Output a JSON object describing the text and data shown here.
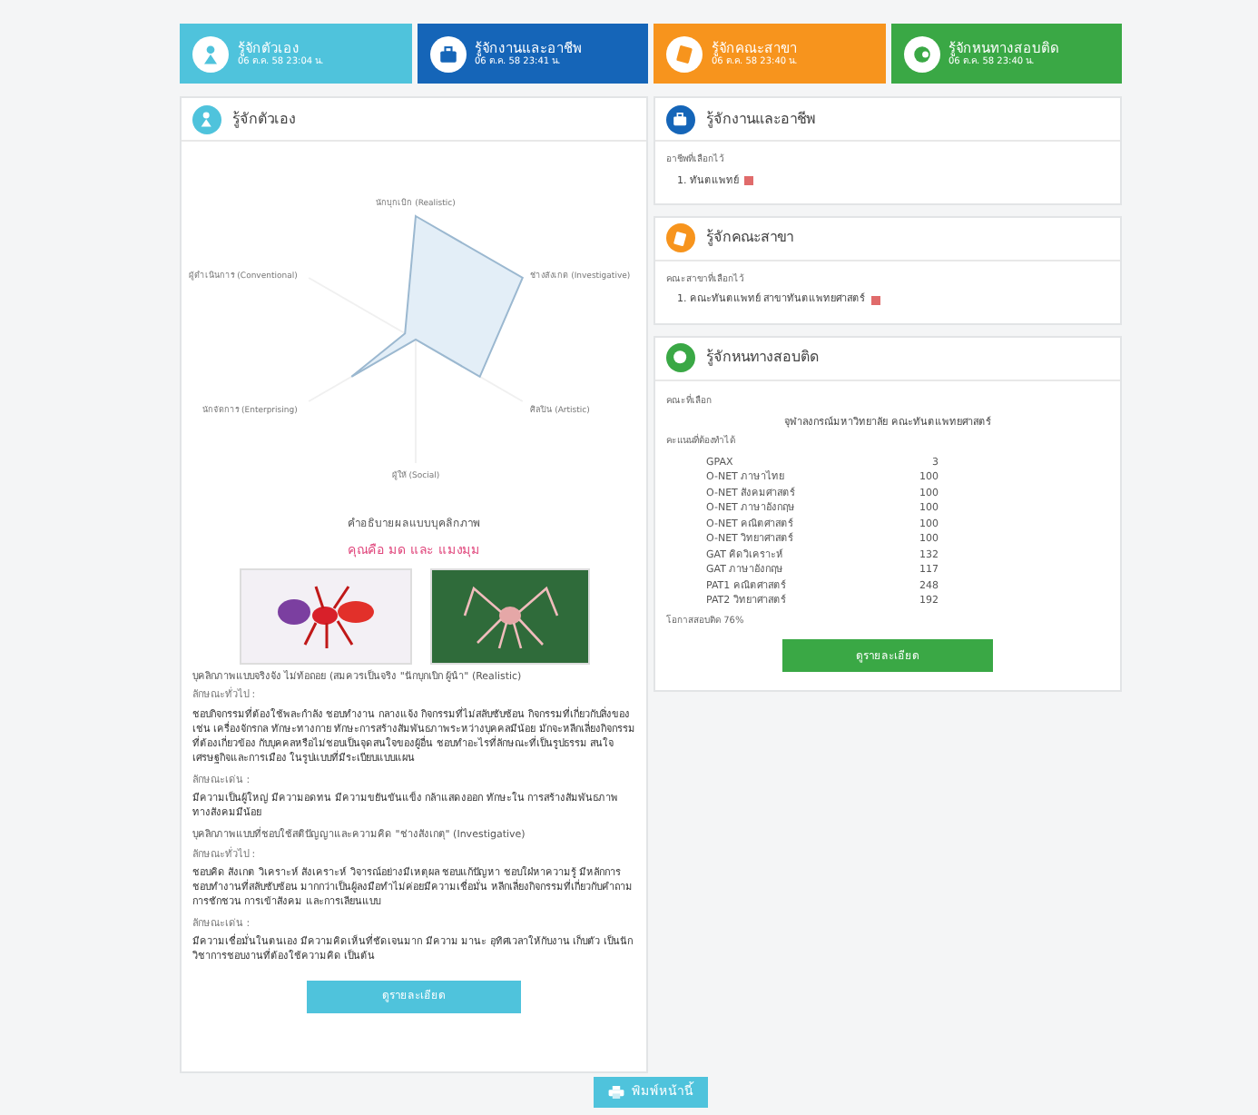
{
  "summary_cards": [
    {
      "title": "รู้จักตัวเอง",
      "time": "06 ต.ค. 58 23:04 น.",
      "color": "#4fc3dc",
      "kind": "person"
    },
    {
      "title": "รู้จักงานและอาชีพ",
      "time": "06 ต.ค. 58 23:41 น.",
      "color": "#1565b8",
      "kind": "briefcase"
    },
    {
      "title": "รู้จักคณะสาขา",
      "time": "06 ต.ค. 58 23:40 น.",
      "color": "#f7941d",
      "kind": "book"
    },
    {
      "title": "รู้จักหนทางสอบติด",
      "time": "06 ต.ค. 58 23:40 น.",
      "color": "#3aa845",
      "kind": "target"
    }
  ],
  "self_panel": {
    "title": "รู้จักตัวเอง",
    "radar_labels": [
      "นักบุกเบิก (Realistic)",
      "ผู้ดำเนินการ (Conventional)",
      "ช่างสังเกต (Investigative)",
      "นักจัดการ (Enterprising)",
      "ศิลปิน (Artistic)",
      "ผู้ให้ (Social)"
    ],
    "caption": "คำอธิบายผลแบบบุคลิกภาพ",
    "result": "คุณคือ มด และ แมงมุม",
    "sections": [
      {
        "kind": "heading",
        "text": "บุคลิกภาพแบบจริงจัง ไม่ท้อถอย (สมควรเป็นจริง \"นักบุกเบิก ผู้นำ\" (Realistic)"
      },
      {
        "kind": "label",
        "text": "ลักษณะทั่วไป :"
      },
      {
        "kind": "body",
        "text": "ชอบกิจกรรมที่ต้องใช้พละกำลัง ชอบทำงาน กลางแจ้ง กิจกรรมที่ไม่สลับซับซ้อน กิจกรรมที่เกี่ยวกับสิ่งของ เช่น เครื่องจักรกล ทักษะทางกาย ทักษะการสร้างสัมพันธภาพระหว่างบุคคลมีน้อย มักจะหลีกเลี่ยงกิจกรรมที่ต้องเกี่ยวข้อง กับบุคคลหรือไม่ชอบเป็นจุดสนใจของผู้อื่น ชอบทำอะไรที่ลักษณะที่เป็นรูปธรรม สนใจเศรษฐกิจและการเมือง ในรูปแบบที่มีระเบียบแบบแผน"
      },
      {
        "kind": "label",
        "text": "ลักษณะเด่น :"
      },
      {
        "kind": "body",
        "text": "มีความเป็นผู้ใหญ่ มีความอดทน มีความขยันขันแข็ง กล้าแสดงออก ทักษะใน การสร้างสัมพันธภาพทางสังคมมีน้อย"
      },
      {
        "kind": "heading",
        "text": "บุคลิกภาพแบบที่ชอบใช้สติปัญญาและความคิด \"ช่างสังเกตุ\" (Investigative)"
      },
      {
        "kind": "label",
        "text": "ลักษณะทั่วไป :"
      },
      {
        "kind": "body",
        "text": "ชอบคิด สังเกต วิเคราะห์ สังเคราะห์ วิจารณ์อย่างมีเหตุผล ชอบแก้ปัญหา ชอบใฝ่หาความรู้ มีหลักการ ชอบทำงานที่สลับซับซ้อน มากกว่าเป็นผู้ลงมือทำไม่ค่อยมีความเชื่อมั่น หลีกเลี่ยงกิจกรรมที่เกี่ยวกับคำถาม การชักชวน การเข้าสังคม และการเลียนแบบ"
      },
      {
        "kind": "label",
        "text": "ลักษณะเด่น :"
      },
      {
        "kind": "body",
        "text": "มีความเชื่อมั่นในตนเอง มีความคิดเห็นที่ชัดเจนมาก มีความ มานะ อุทิศเวลาให้กับงาน เก็บตัว เป็นนักวิชาการชอบงานที่ต้องใช้ความคิด เป็นต้น"
      }
    ],
    "button": "ดูรายละเอียด"
  },
  "job_panel": {
    "title": "รู้จักงานและอาชีพ",
    "label": "อาชีพที่เลือกไว้",
    "items": [
      "1. ทันตแพทย์"
    ]
  },
  "faculty_panel": {
    "title": "รู้จักคณะสาขา",
    "label": "คณะสาขาที่เลือกไว้",
    "items": [
      "1. คณะทันตแพทย์ สาขาทันตแพทยศาสตร์"
    ]
  },
  "exam_panel": {
    "title": "รู้จักหนทางสอบติด",
    "choice_label": "คณะที่เลือก",
    "choice": "จุฬาลงกรณ์มหาวิทยาลัย คณะทันตแพทยศาสตร์",
    "scores_label": "คะแนนที่ต้องทำได้",
    "scores": [
      {
        "subject": "GPAX",
        "score": "3"
      },
      {
        "subject": "O-NET ภาษาไทย",
        "score": "100"
      },
      {
        "subject": "O-NET สังคมศาสตร์",
        "score": "100"
      },
      {
        "subject": "O-NET ภาษาอังกฤษ",
        "score": "100"
      },
      {
        "subject": "O-NET คณิตศาสตร์",
        "score": "100"
      },
      {
        "subject": "O-NET วิทยาศาสตร์",
        "score": "100"
      },
      {
        "subject": "GAT คิดวิเคราะห์",
        "score": "132"
      },
      {
        "subject": "GAT ภาษาอังกฤษ",
        "score": "117"
      },
      {
        "subject": "PAT1 คณิตศาสตร์",
        "score": "248"
      },
      {
        "subject": "PAT2 วิทยาศาสตร์",
        "score": "192"
      }
    ],
    "chance": "โอกาสสอบติด 76%",
    "button": "ดูรายละเอียด"
  },
  "print_button": "พิมพ์หน้านี้"
}
